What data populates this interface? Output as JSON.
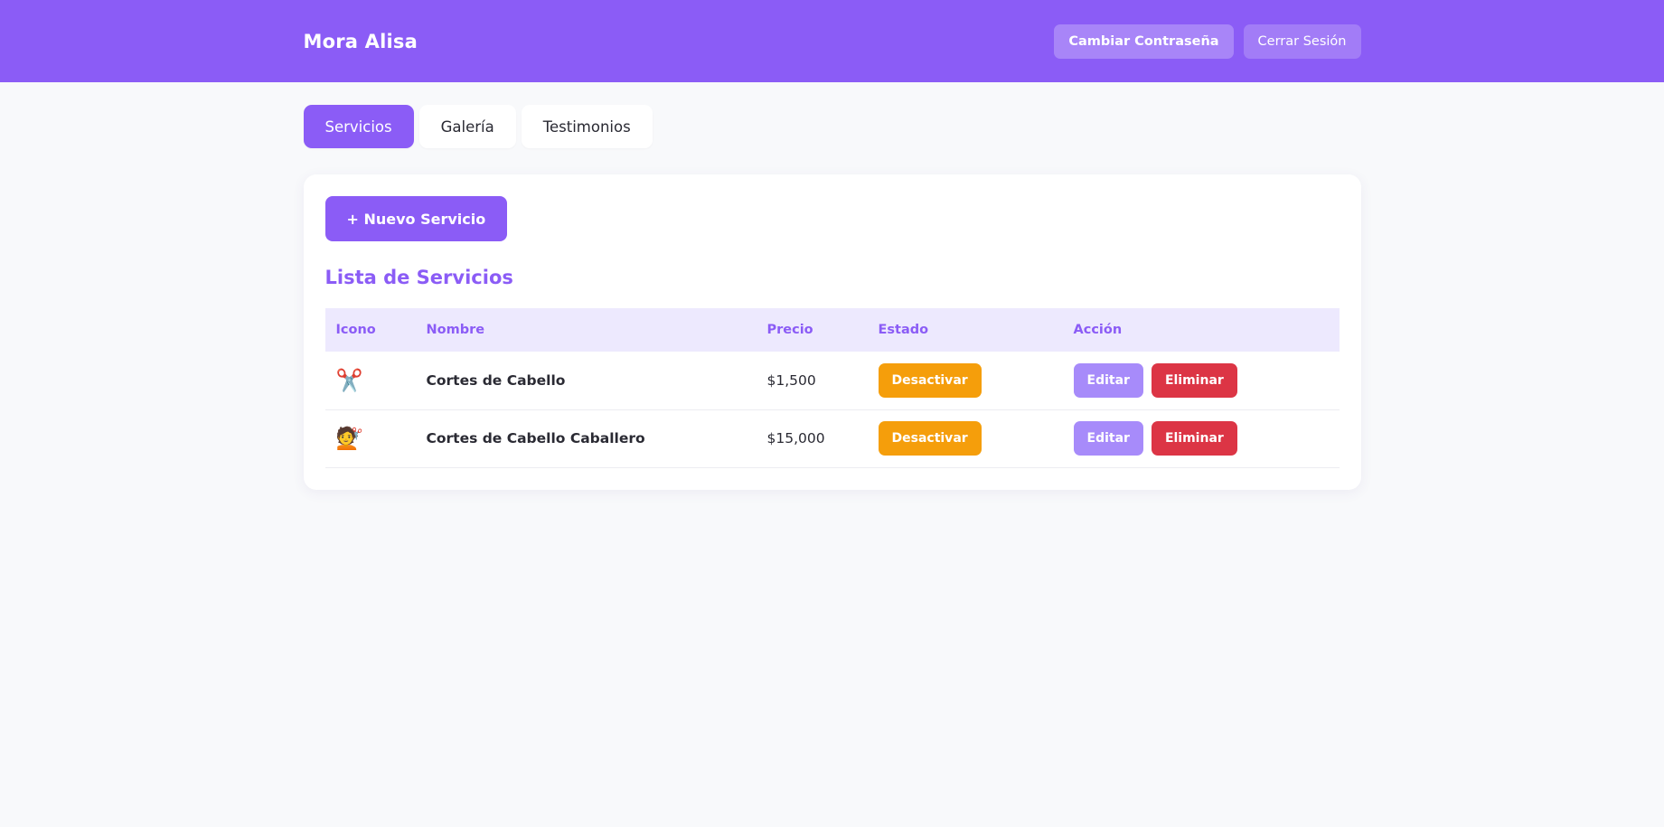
{
  "header": {
    "brand": "Mora Alisa",
    "change_password_label": "Cambiar Contraseña",
    "logout_label": "Cerrar Sesión"
  },
  "tabs": [
    {
      "label": "Servicios",
      "active": true
    },
    {
      "label": "Galería",
      "active": false
    },
    {
      "label": "Testimonios",
      "active": false
    }
  ],
  "main": {
    "new_service_label": "+ Nuevo Servicio",
    "list_title": "Lista de Servicios",
    "columns": [
      "Icono",
      "Nombre",
      "Precio",
      "Estado",
      "Acción"
    ],
    "rows": [
      {
        "icon": "✂️",
        "icon_name": "scissors-icon",
        "name": "Cortes de Cabello",
        "price": "$1,500",
        "status_label": "Desactivar",
        "edit_label": "Editar",
        "delete_label": "Eliminar"
      },
      {
        "icon": "💇",
        "icon_name": "haircut-person-icon",
        "name": "Cortes de Cabello Caballero",
        "price": "$15,000",
        "status_label": "Desactivar",
        "edit_label": "Editar",
        "delete_label": "Eliminar"
      }
    ]
  },
  "colors": {
    "primary": "#8b5cf6",
    "warning": "#f59e0b",
    "edit": "#a78bfa",
    "danger": "#dc3545",
    "table_header_bg": "#ede9fe"
  }
}
